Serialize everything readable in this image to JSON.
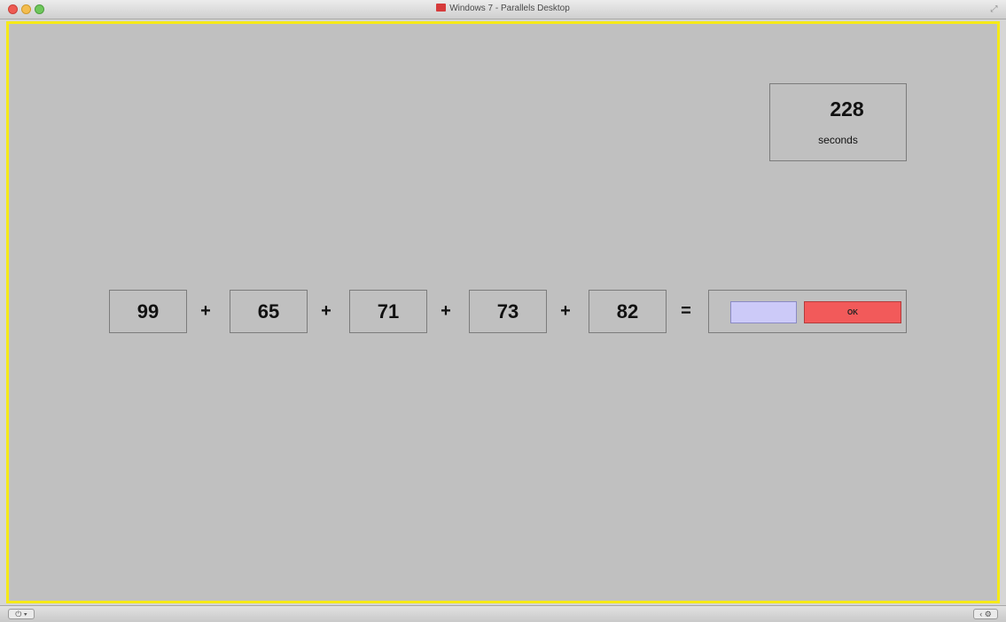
{
  "window": {
    "title": "Windows 7 - Parallels Desktop"
  },
  "timer": {
    "value": "228",
    "unit": "seconds"
  },
  "equation": {
    "terms": [
      "99",
      "65",
      "71",
      "73",
      "82"
    ],
    "operator": "+",
    "equals": "=",
    "answer_value": "",
    "ok_label": "OK"
  },
  "icons": {
    "power": "⏻ ▾",
    "settings": "‹ ⚙"
  },
  "colors": {
    "frame": "#f6ea18",
    "background": "#c0c0c0",
    "input": "#cccaf8",
    "ok_button": "#f25a5a"
  }
}
